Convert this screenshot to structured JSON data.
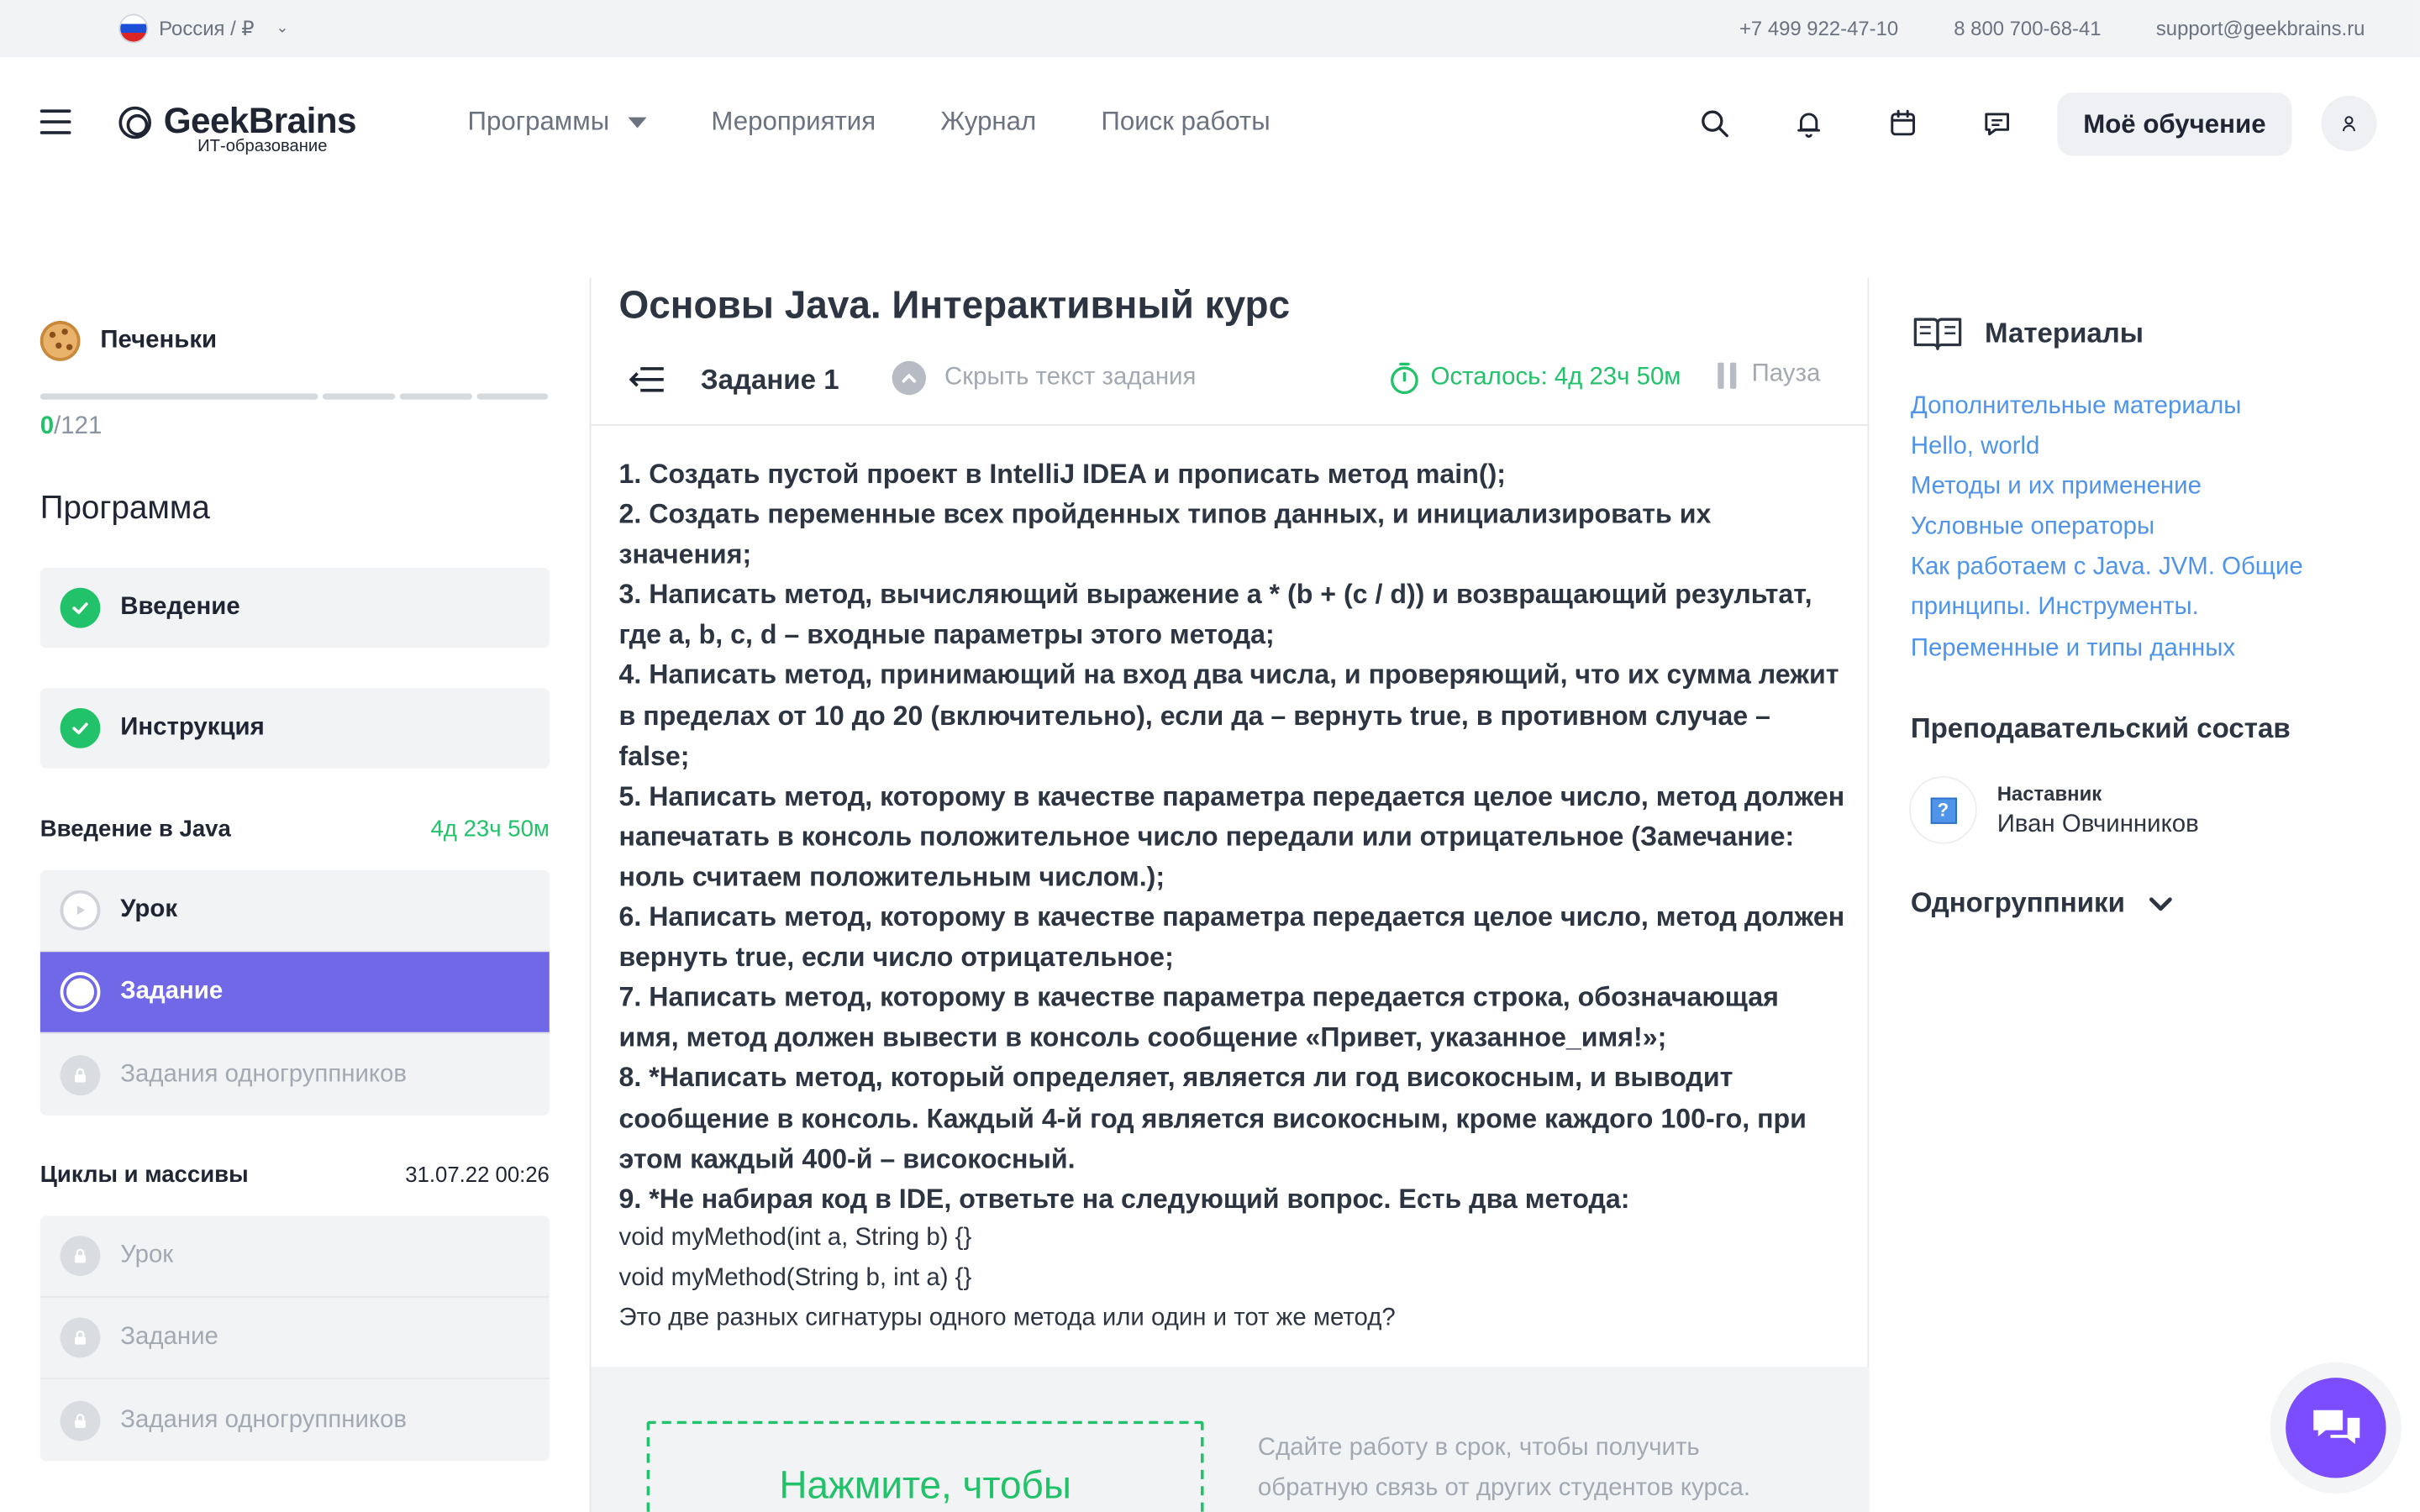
{
  "topbar": {
    "region": "Россия / ₽",
    "phone1": "+7 499 922-47-10",
    "phone2": "8 800 700-68-41",
    "email": "support@geekbrains.ru"
  },
  "header": {
    "brand": "GeekBrains",
    "tagline": "ИТ-образование",
    "nav": [
      "Программы",
      "Мероприятия",
      "Журнал",
      "Поиск работы"
    ],
    "my_learning": "Моё обучение"
  },
  "sidebar": {
    "cookies_label": "Печеньки",
    "score_current": "0",
    "score_total": "/121",
    "program_heading": "Программа",
    "intro_items": [
      "Введение",
      "Инструкция"
    ],
    "group1": {
      "title": "Введение в Java",
      "time": "4д 23ч 50м",
      "items": [
        "Урок",
        "Задание",
        "Задания одногруппников"
      ]
    },
    "group2": {
      "title": "Циклы и массивы",
      "time": "31.07.22 00:26",
      "items": [
        "Урок",
        "Задание",
        "Задания одногруппников"
      ]
    }
  },
  "main": {
    "title": "Основы Java. Интерактивный курс",
    "task_name": "Задание 1",
    "hide_text": "Скрыть текст задания",
    "remaining": "Осталось: 4д 23ч 50м",
    "pause": "Пауза",
    "task_lines": [
      "1. Создать пустой проект в IntelliJ IDEA и прописать метод main();",
      "2. Создать переменные всех пройденных типов данных, и инициализировать их значения;",
      "3. Написать метод, вычисляющий выражение a * (b + (c / d)) и возвращающий результат, где a, b, c, d – входные параметры этого метода;",
      "4. Написать метод, принимающий на вход два числа, и проверяющий, что их сумма лежит в пределах от 10 до 20 (включительно), если да – вернуть true, в противном случае – false;",
      "5. Написать метод, которому в качестве параметра передается целое число, метод должен напечатать в консоль положительное число передали или отрицательное (Замечание: ноль считаем положительным числом.);",
      "6. Написать метод, которому в качестве параметра передается целое число, метод должен вернуть true, если число отрицательное;",
      "7. Написать метод, которому в качестве параметра передается строка, обозначающая имя, метод должен вывести в консоль сообщение «Привет, указанное_имя!»;",
      "8. *Написать метод, который определяет, является ли год високосным, и выводит сообщение в консоль. Каждый 4-й год является високосным, кроме каждого 100-го, при этом каждый 400-й – високосный.",
      "9. *Не набирая код в IDE, ответьте на следующий вопрос. Есть два метода:"
    ],
    "code_lines": [
      "void myMethod(int a, String b) {}",
      "void myMethod(String b, int a) {}",
      "Это две разных сигнатуры одного метода или один и тот же метод?"
    ],
    "dropzone": "Нажмите, чтобы",
    "submit_note": "Сдайте работу в срок, чтобы получить обратную связь от других студентов курса."
  },
  "right": {
    "materials_title": "Материалы",
    "links": [
      "Дополнительные материалы",
      "Hello, world",
      "Методы и их применение",
      "Условные операторы",
      "Как работаем с Java. JVM. Общие принципы. Инструменты.",
      "Переменные и типы данных"
    ],
    "teachers_title": "Преподавательский состав",
    "teacher_role": "Наставник",
    "teacher_name": "Иван Овчинников",
    "classmates": "Одногруппники"
  },
  "colors": {
    "accent_purple": "#7068e6",
    "success_green": "#22c26a",
    "link_blue": "#4f94e8",
    "chat_purple": "#7c4dff"
  }
}
